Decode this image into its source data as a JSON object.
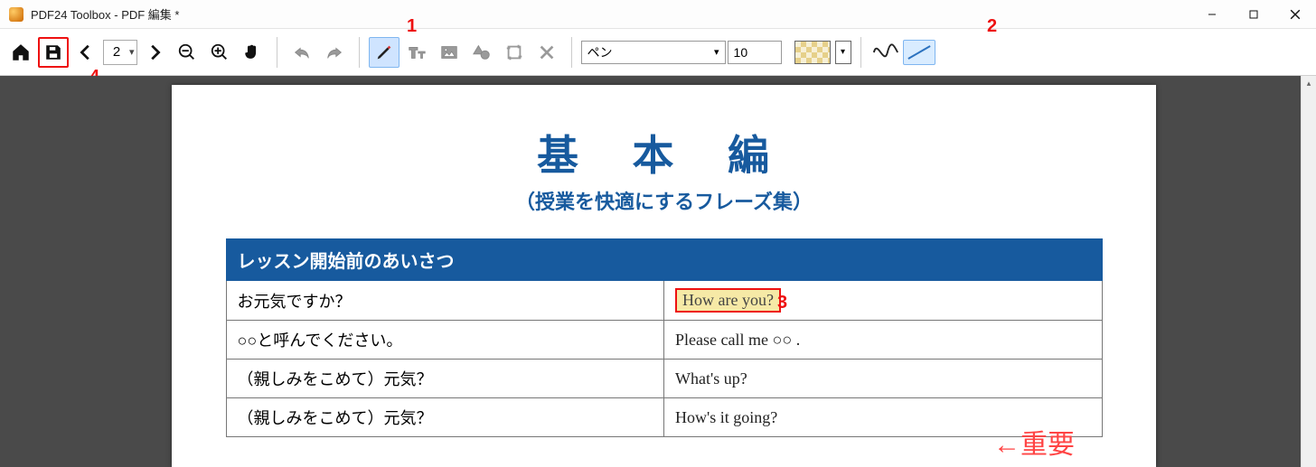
{
  "window": {
    "title": "PDF24 Toolbox - PDF 編集 *"
  },
  "toolbar": {
    "page_number": "2",
    "tool_select_label": "ペン",
    "stroke_size": "10"
  },
  "callouts": {
    "c1": "1",
    "c2": "2",
    "c3": "3",
    "c4": "4"
  },
  "document": {
    "title": "基 本 編",
    "subtitle": "（授業を快適にするフレーズ集）",
    "section_header": "レッスン開始前のあいさつ",
    "rows": [
      {
        "jp": "お元気ですか？",
        "en": "How are you?"
      },
      {
        "jp": "○○と呼んでください。",
        "en": "Please call me ○○ ."
      },
      {
        "jp": "（親しみをこめて）元気？",
        "en": "What's up?"
      },
      {
        "jp": "（親しみをこめて）元気？",
        "en": "How's it going?"
      }
    ],
    "annotation": "←重要"
  }
}
